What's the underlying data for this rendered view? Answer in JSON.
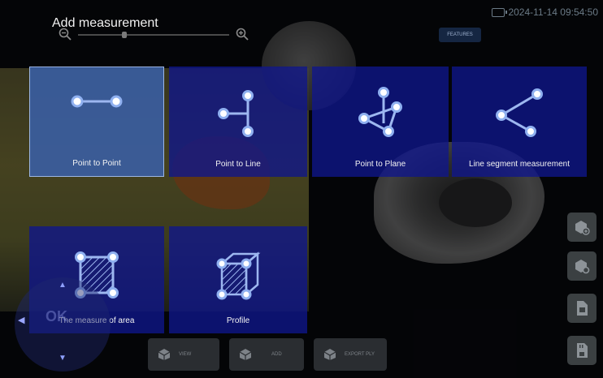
{
  "dialog": {
    "title": "Add measurement"
  },
  "status": {
    "datetime": "2024-11-14 09:54:50"
  },
  "zoom": {
    "level": 0.3
  },
  "top_button": {
    "label": "FEATURES"
  },
  "measurements": [
    {
      "label": "Point to Point",
      "icon": "point-to-point-icon",
      "selected": true
    },
    {
      "label": "Point to Line",
      "icon": "point-to-line-icon",
      "selected": false
    },
    {
      "label": "Point to Plane",
      "icon": "point-to-plane-icon",
      "selected": false
    },
    {
      "label": "Line segment measurement",
      "icon": "line-segment-icon",
      "selected": false
    },
    {
      "label": "The measure of area",
      "icon": "area-icon",
      "selected": false
    },
    {
      "label": "Profile",
      "icon": "profile-icon",
      "selected": false
    }
  ],
  "bottom_toolbar": [
    {
      "label": "VIEW",
      "icon": "cube-view-icon"
    },
    {
      "label": "ADD",
      "icon": "cube-add-icon"
    },
    {
      "label": "EXPORT PLY",
      "icon": "cube-export-icon"
    }
  ],
  "side_toolbar": [
    {
      "icon": "cube-plus-icon"
    },
    {
      "icon": "cube-settings-icon"
    },
    {
      "icon": "document-icon"
    },
    {
      "icon": "sd-card-icon"
    }
  ],
  "joystick": {
    "center_label": "OK"
  },
  "colors": {
    "tile": "#0f168c",
    "tile_selected": "#3a60aa",
    "icon_stroke": "#9db7f0",
    "node_fill": "#ffffff"
  }
}
